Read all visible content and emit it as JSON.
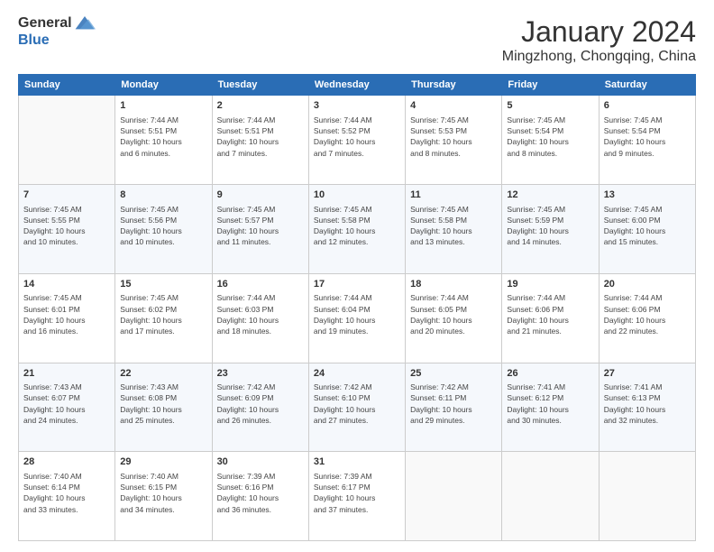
{
  "header": {
    "logo_general": "General",
    "logo_blue": "Blue",
    "title": "January 2024",
    "subtitle": "Mingzhong, Chongqing, China"
  },
  "columns": [
    "Sunday",
    "Monday",
    "Tuesday",
    "Wednesday",
    "Thursday",
    "Friday",
    "Saturday"
  ],
  "weeks": [
    [
      {
        "day": "",
        "info": ""
      },
      {
        "day": "1",
        "info": "Sunrise: 7:44 AM\nSunset: 5:51 PM\nDaylight: 10 hours\nand 6 minutes."
      },
      {
        "day": "2",
        "info": "Sunrise: 7:44 AM\nSunset: 5:51 PM\nDaylight: 10 hours\nand 7 minutes."
      },
      {
        "day": "3",
        "info": "Sunrise: 7:44 AM\nSunset: 5:52 PM\nDaylight: 10 hours\nand 7 minutes."
      },
      {
        "day": "4",
        "info": "Sunrise: 7:45 AM\nSunset: 5:53 PM\nDaylight: 10 hours\nand 8 minutes."
      },
      {
        "day": "5",
        "info": "Sunrise: 7:45 AM\nSunset: 5:54 PM\nDaylight: 10 hours\nand 8 minutes."
      },
      {
        "day": "6",
        "info": "Sunrise: 7:45 AM\nSunset: 5:54 PM\nDaylight: 10 hours\nand 9 minutes."
      }
    ],
    [
      {
        "day": "7",
        "info": "Sunrise: 7:45 AM\nSunset: 5:55 PM\nDaylight: 10 hours\nand 10 minutes."
      },
      {
        "day": "8",
        "info": "Sunrise: 7:45 AM\nSunset: 5:56 PM\nDaylight: 10 hours\nand 10 minutes."
      },
      {
        "day": "9",
        "info": "Sunrise: 7:45 AM\nSunset: 5:57 PM\nDaylight: 10 hours\nand 11 minutes."
      },
      {
        "day": "10",
        "info": "Sunrise: 7:45 AM\nSunset: 5:58 PM\nDaylight: 10 hours\nand 12 minutes."
      },
      {
        "day": "11",
        "info": "Sunrise: 7:45 AM\nSunset: 5:58 PM\nDaylight: 10 hours\nand 13 minutes."
      },
      {
        "day": "12",
        "info": "Sunrise: 7:45 AM\nSunset: 5:59 PM\nDaylight: 10 hours\nand 14 minutes."
      },
      {
        "day": "13",
        "info": "Sunrise: 7:45 AM\nSunset: 6:00 PM\nDaylight: 10 hours\nand 15 minutes."
      }
    ],
    [
      {
        "day": "14",
        "info": "Sunrise: 7:45 AM\nSunset: 6:01 PM\nDaylight: 10 hours\nand 16 minutes."
      },
      {
        "day": "15",
        "info": "Sunrise: 7:45 AM\nSunset: 6:02 PM\nDaylight: 10 hours\nand 17 minutes."
      },
      {
        "day": "16",
        "info": "Sunrise: 7:44 AM\nSunset: 6:03 PM\nDaylight: 10 hours\nand 18 minutes."
      },
      {
        "day": "17",
        "info": "Sunrise: 7:44 AM\nSunset: 6:04 PM\nDaylight: 10 hours\nand 19 minutes."
      },
      {
        "day": "18",
        "info": "Sunrise: 7:44 AM\nSunset: 6:05 PM\nDaylight: 10 hours\nand 20 minutes."
      },
      {
        "day": "19",
        "info": "Sunrise: 7:44 AM\nSunset: 6:06 PM\nDaylight: 10 hours\nand 21 minutes."
      },
      {
        "day": "20",
        "info": "Sunrise: 7:44 AM\nSunset: 6:06 PM\nDaylight: 10 hours\nand 22 minutes."
      }
    ],
    [
      {
        "day": "21",
        "info": "Sunrise: 7:43 AM\nSunset: 6:07 PM\nDaylight: 10 hours\nand 24 minutes."
      },
      {
        "day": "22",
        "info": "Sunrise: 7:43 AM\nSunset: 6:08 PM\nDaylight: 10 hours\nand 25 minutes."
      },
      {
        "day": "23",
        "info": "Sunrise: 7:42 AM\nSunset: 6:09 PM\nDaylight: 10 hours\nand 26 minutes."
      },
      {
        "day": "24",
        "info": "Sunrise: 7:42 AM\nSunset: 6:10 PM\nDaylight: 10 hours\nand 27 minutes."
      },
      {
        "day": "25",
        "info": "Sunrise: 7:42 AM\nSunset: 6:11 PM\nDaylight: 10 hours\nand 29 minutes."
      },
      {
        "day": "26",
        "info": "Sunrise: 7:41 AM\nSunset: 6:12 PM\nDaylight: 10 hours\nand 30 minutes."
      },
      {
        "day": "27",
        "info": "Sunrise: 7:41 AM\nSunset: 6:13 PM\nDaylight: 10 hours\nand 32 minutes."
      }
    ],
    [
      {
        "day": "28",
        "info": "Sunrise: 7:40 AM\nSunset: 6:14 PM\nDaylight: 10 hours\nand 33 minutes."
      },
      {
        "day": "29",
        "info": "Sunrise: 7:40 AM\nSunset: 6:15 PM\nDaylight: 10 hours\nand 34 minutes."
      },
      {
        "day": "30",
        "info": "Sunrise: 7:39 AM\nSunset: 6:16 PM\nDaylight: 10 hours\nand 36 minutes."
      },
      {
        "day": "31",
        "info": "Sunrise: 7:39 AM\nSunset: 6:17 PM\nDaylight: 10 hours\nand 37 minutes."
      },
      {
        "day": "",
        "info": ""
      },
      {
        "day": "",
        "info": ""
      },
      {
        "day": "",
        "info": ""
      }
    ]
  ]
}
